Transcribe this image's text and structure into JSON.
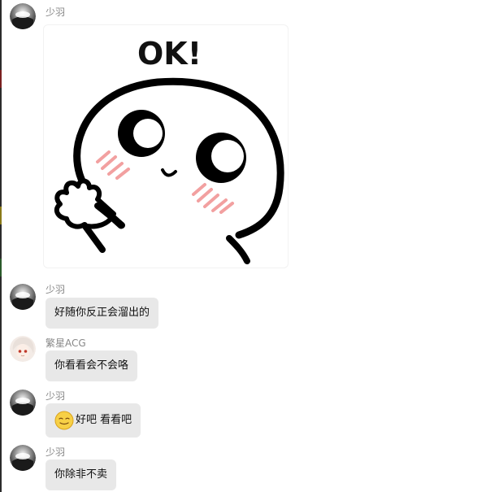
{
  "messages": [
    {
      "sender": "少羽",
      "type": "sticker",
      "sticker_text": "OK!"
    },
    {
      "sender": "少羽",
      "type": "text",
      "text": "好随你反正会溜出的"
    },
    {
      "sender": "繁星ACG",
      "type": "text",
      "text": "你看看会不会咯"
    },
    {
      "sender": "少羽",
      "type": "text",
      "emoji": "smiley-emoji",
      "text": "好吧 看看吧"
    },
    {
      "sender": "少羽",
      "type": "text",
      "text": "你除非不卖"
    }
  ],
  "colors": {
    "bubble": "#e8e8e8",
    "name": "#888888",
    "text": "#111111",
    "blush": "#f2a0a0"
  }
}
